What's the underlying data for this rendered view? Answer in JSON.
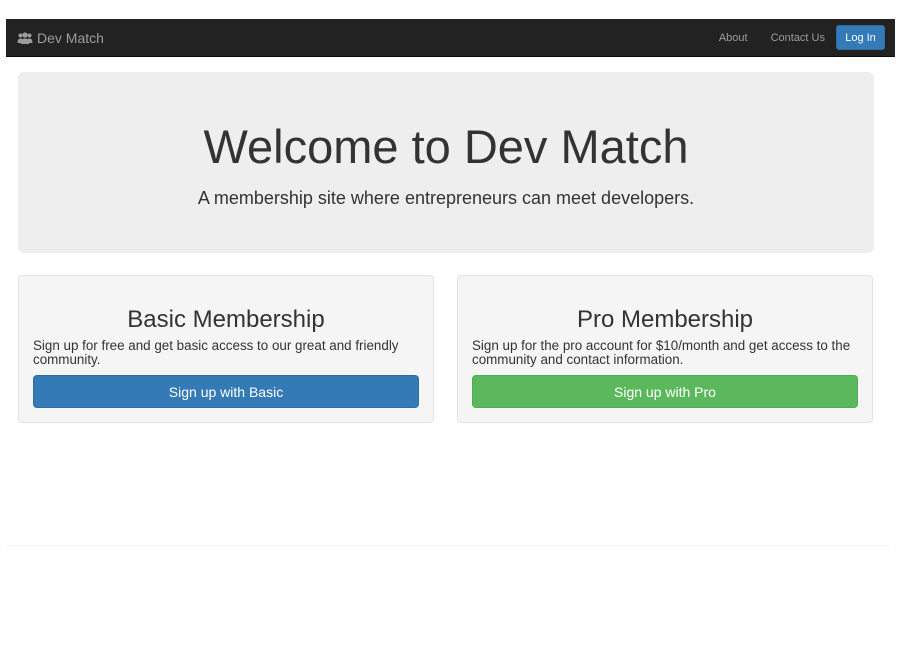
{
  "navbar": {
    "brand": {
      "icon": "users-icon",
      "label": "Dev Match"
    },
    "links": [
      {
        "label": "About"
      },
      {
        "label": "Contact Us"
      }
    ],
    "login_label": "Log In"
  },
  "jumbotron": {
    "title": "Welcome to Dev Match",
    "subtitle": "A membership site where entrepreneurs can meet developers."
  },
  "plans": {
    "basic": {
      "title": "Basic Membership",
      "description": "Sign up for free and get basic access to our great and friendly community.",
      "button_label": "Sign up with Basic"
    },
    "pro": {
      "title": "Pro Membership",
      "description": "Sign up for the pro account for $10/month and get access to the community and contact information.",
      "button_label": "Sign up with Pro"
    }
  },
  "colors": {
    "navbar_bg": "#222222",
    "primary": "#337ab7",
    "success": "#5cb85c",
    "jumbotron_bg": "#eeeeee",
    "panel_bg": "#f5f5f5"
  }
}
